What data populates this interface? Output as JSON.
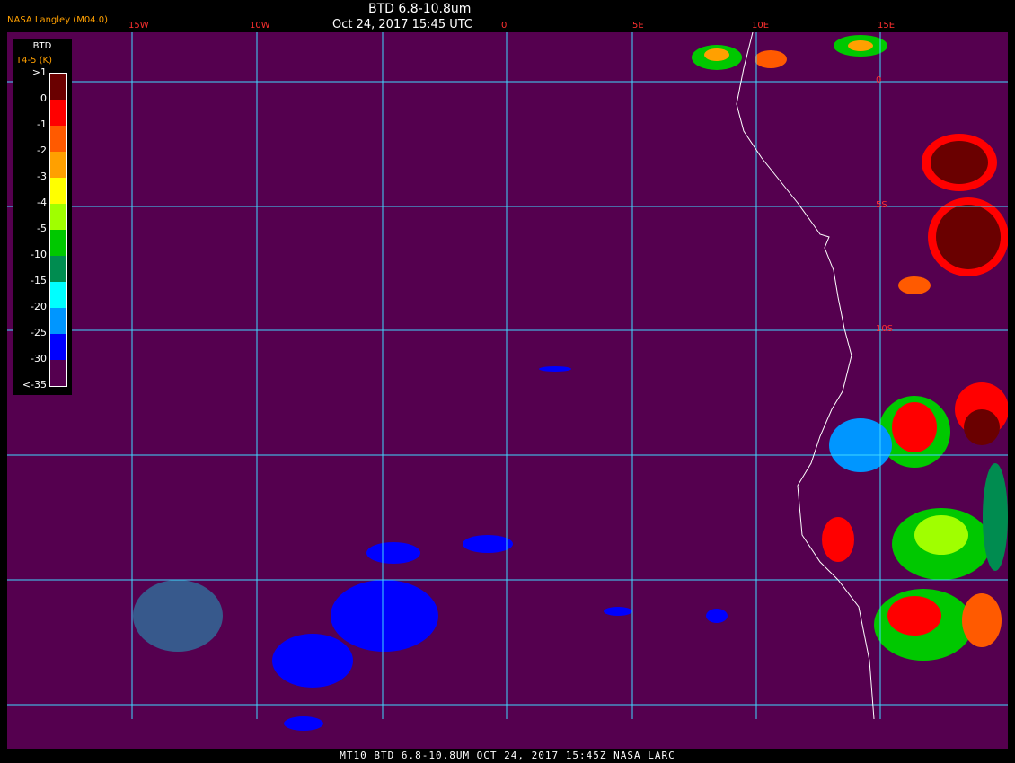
{
  "header": {
    "title": "BTD 6.8-10.8um",
    "datetime": "Oct 24, 2017 15:45 UTC",
    "org": "NASA Langley (M04.0)"
  },
  "longitude_labels": [
    "15W",
    "10W",
    "0",
    "5E",
    "10E",
    "15E"
  ],
  "latitude_labels": [
    "0",
    "5S",
    "10S"
  ],
  "legend": {
    "title": "BTD",
    "subtitle": "T4-5 (K)",
    "ticks": [
      ">1",
      "0",
      "-1",
      "-2",
      "-3",
      "-4",
      "-5",
      "-10",
      "-15",
      "-20",
      "-25",
      "-30",
      "<-35"
    ],
    "colors": [
      "#6a0000",
      "#ff0000",
      "#ff5a00",
      "#ffa000",
      "#ffff00",
      "#a0ff00",
      "#00c800",
      "#008c50",
      "#00ffff",
      "#0096ff",
      "#0000ff",
      "#55004f"
    ]
  },
  "footer": "MT10  BTD 6.8-10.8UM   OCT 24, 2017 15:45Z   NASA LARC"
}
